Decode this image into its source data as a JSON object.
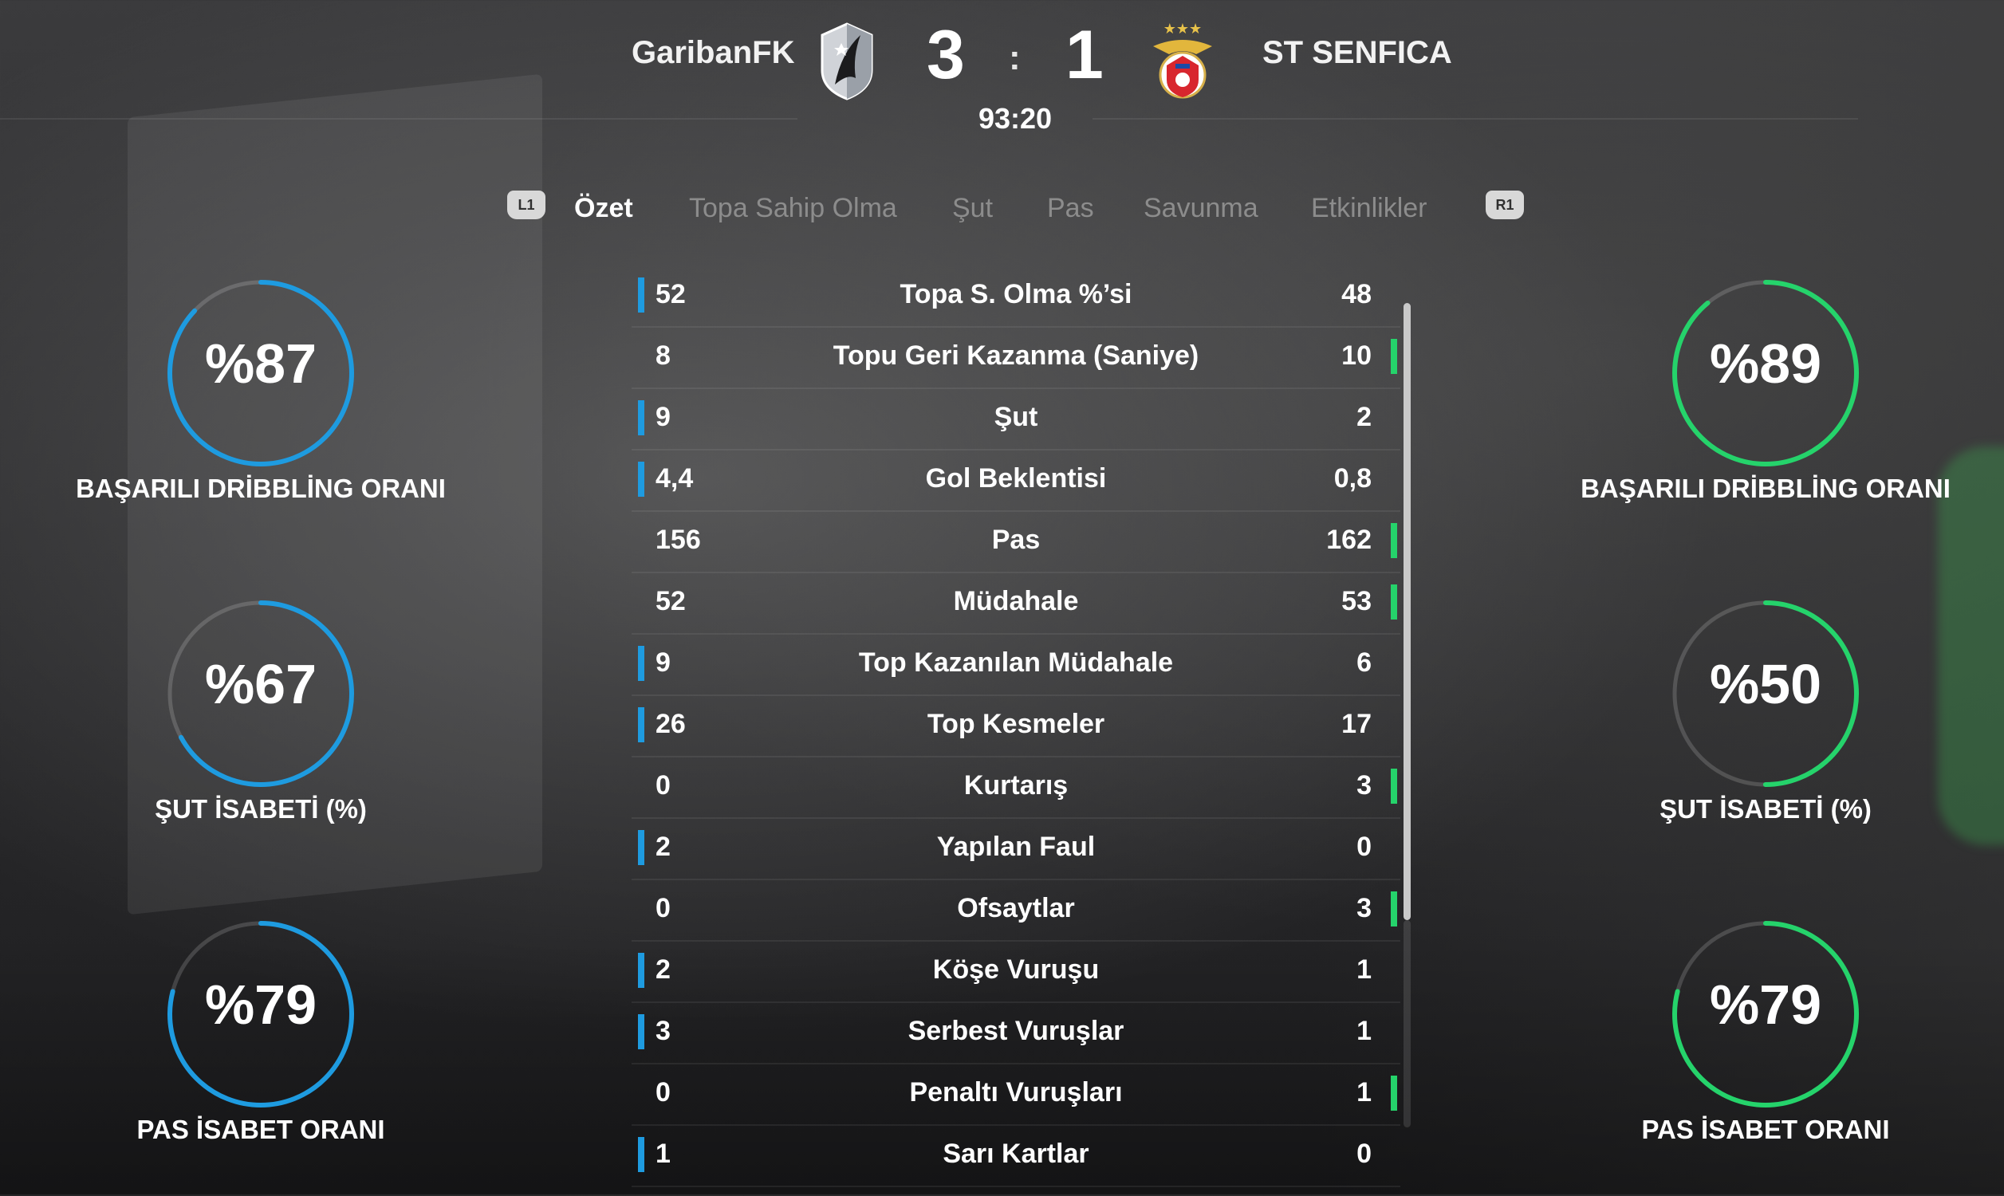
{
  "match": {
    "home_team": "GaribanFK",
    "away_team": "ST SENFICA",
    "home_score": "3",
    "separator": ":",
    "away_score": "1",
    "clock": "93:20"
  },
  "tabs": {
    "left_shoulder": "L1",
    "right_shoulder": "R1",
    "items": [
      "Özet",
      "Topa Sahip Olma",
      "Şut",
      "Pas",
      "Savunma",
      "Etkinlikler"
    ],
    "active": "Özet"
  },
  "colors": {
    "home_accent": "#1e9be0",
    "away_accent": "#25d36b"
  },
  "stats": [
    {
      "label": "Topa S. Olma %’si",
      "home": "52",
      "away": "48",
      "leader": "home"
    },
    {
      "label": "Topu Geri Kazanma (Saniye)",
      "home": "8",
      "away": "10",
      "leader": "away"
    },
    {
      "label": "Şut",
      "home": "9",
      "away": "2",
      "leader": "home"
    },
    {
      "label": "Gol Beklentisi",
      "home": "4,4",
      "away": "0,8",
      "leader": "home"
    },
    {
      "label": "Pas",
      "home": "156",
      "away": "162",
      "leader": "away"
    },
    {
      "label": "Müdahale",
      "home": "52",
      "away": "53",
      "leader": "away"
    },
    {
      "label": "Top Kazanılan Müdahale",
      "home": "9",
      "away": "6",
      "leader": "home"
    },
    {
      "label": "Top Kesmeler",
      "home": "26",
      "away": "17",
      "leader": "home"
    },
    {
      "label": "Kurtarış",
      "home": "0",
      "away": "3",
      "leader": "away"
    },
    {
      "label": "Yapılan Faul",
      "home": "2",
      "away": "0",
      "leader": "home"
    },
    {
      "label": "Ofsaytlar",
      "home": "0",
      "away": "3",
      "leader": "away"
    },
    {
      "label": "Köşe Vuruşu",
      "home": "2",
      "away": "1",
      "leader": "home"
    },
    {
      "label": "Serbest Vuruşlar",
      "home": "3",
      "away": "1",
      "leader": "home"
    },
    {
      "label": "Penaltı Vuruşları",
      "home": "0",
      "away": "1",
      "leader": "away"
    },
    {
      "label": "Sarı Kartlar",
      "home": "1",
      "away": "0",
      "leader": "home"
    }
  ],
  "gauges": {
    "home": [
      {
        "value": "%87",
        "percent": 87,
        "label": "BAŞARILI DRİBBLİNG ORANI"
      },
      {
        "value": "%67",
        "percent": 67,
        "label": "ŞUT İSABETİ (%)"
      },
      {
        "value": "%79",
        "percent": 79,
        "label": "PAS İSABET ORANI"
      }
    ],
    "away": [
      {
        "value": "%89",
        "percent": 89,
        "label": "BAŞARILI DRİBBLİNG ORANI"
      },
      {
        "value": "%50",
        "percent": 50,
        "label": "ŞUT İSABETİ (%)"
      },
      {
        "value": "%79",
        "percent": 79,
        "label": "PAS İSABET ORANI"
      }
    ]
  }
}
